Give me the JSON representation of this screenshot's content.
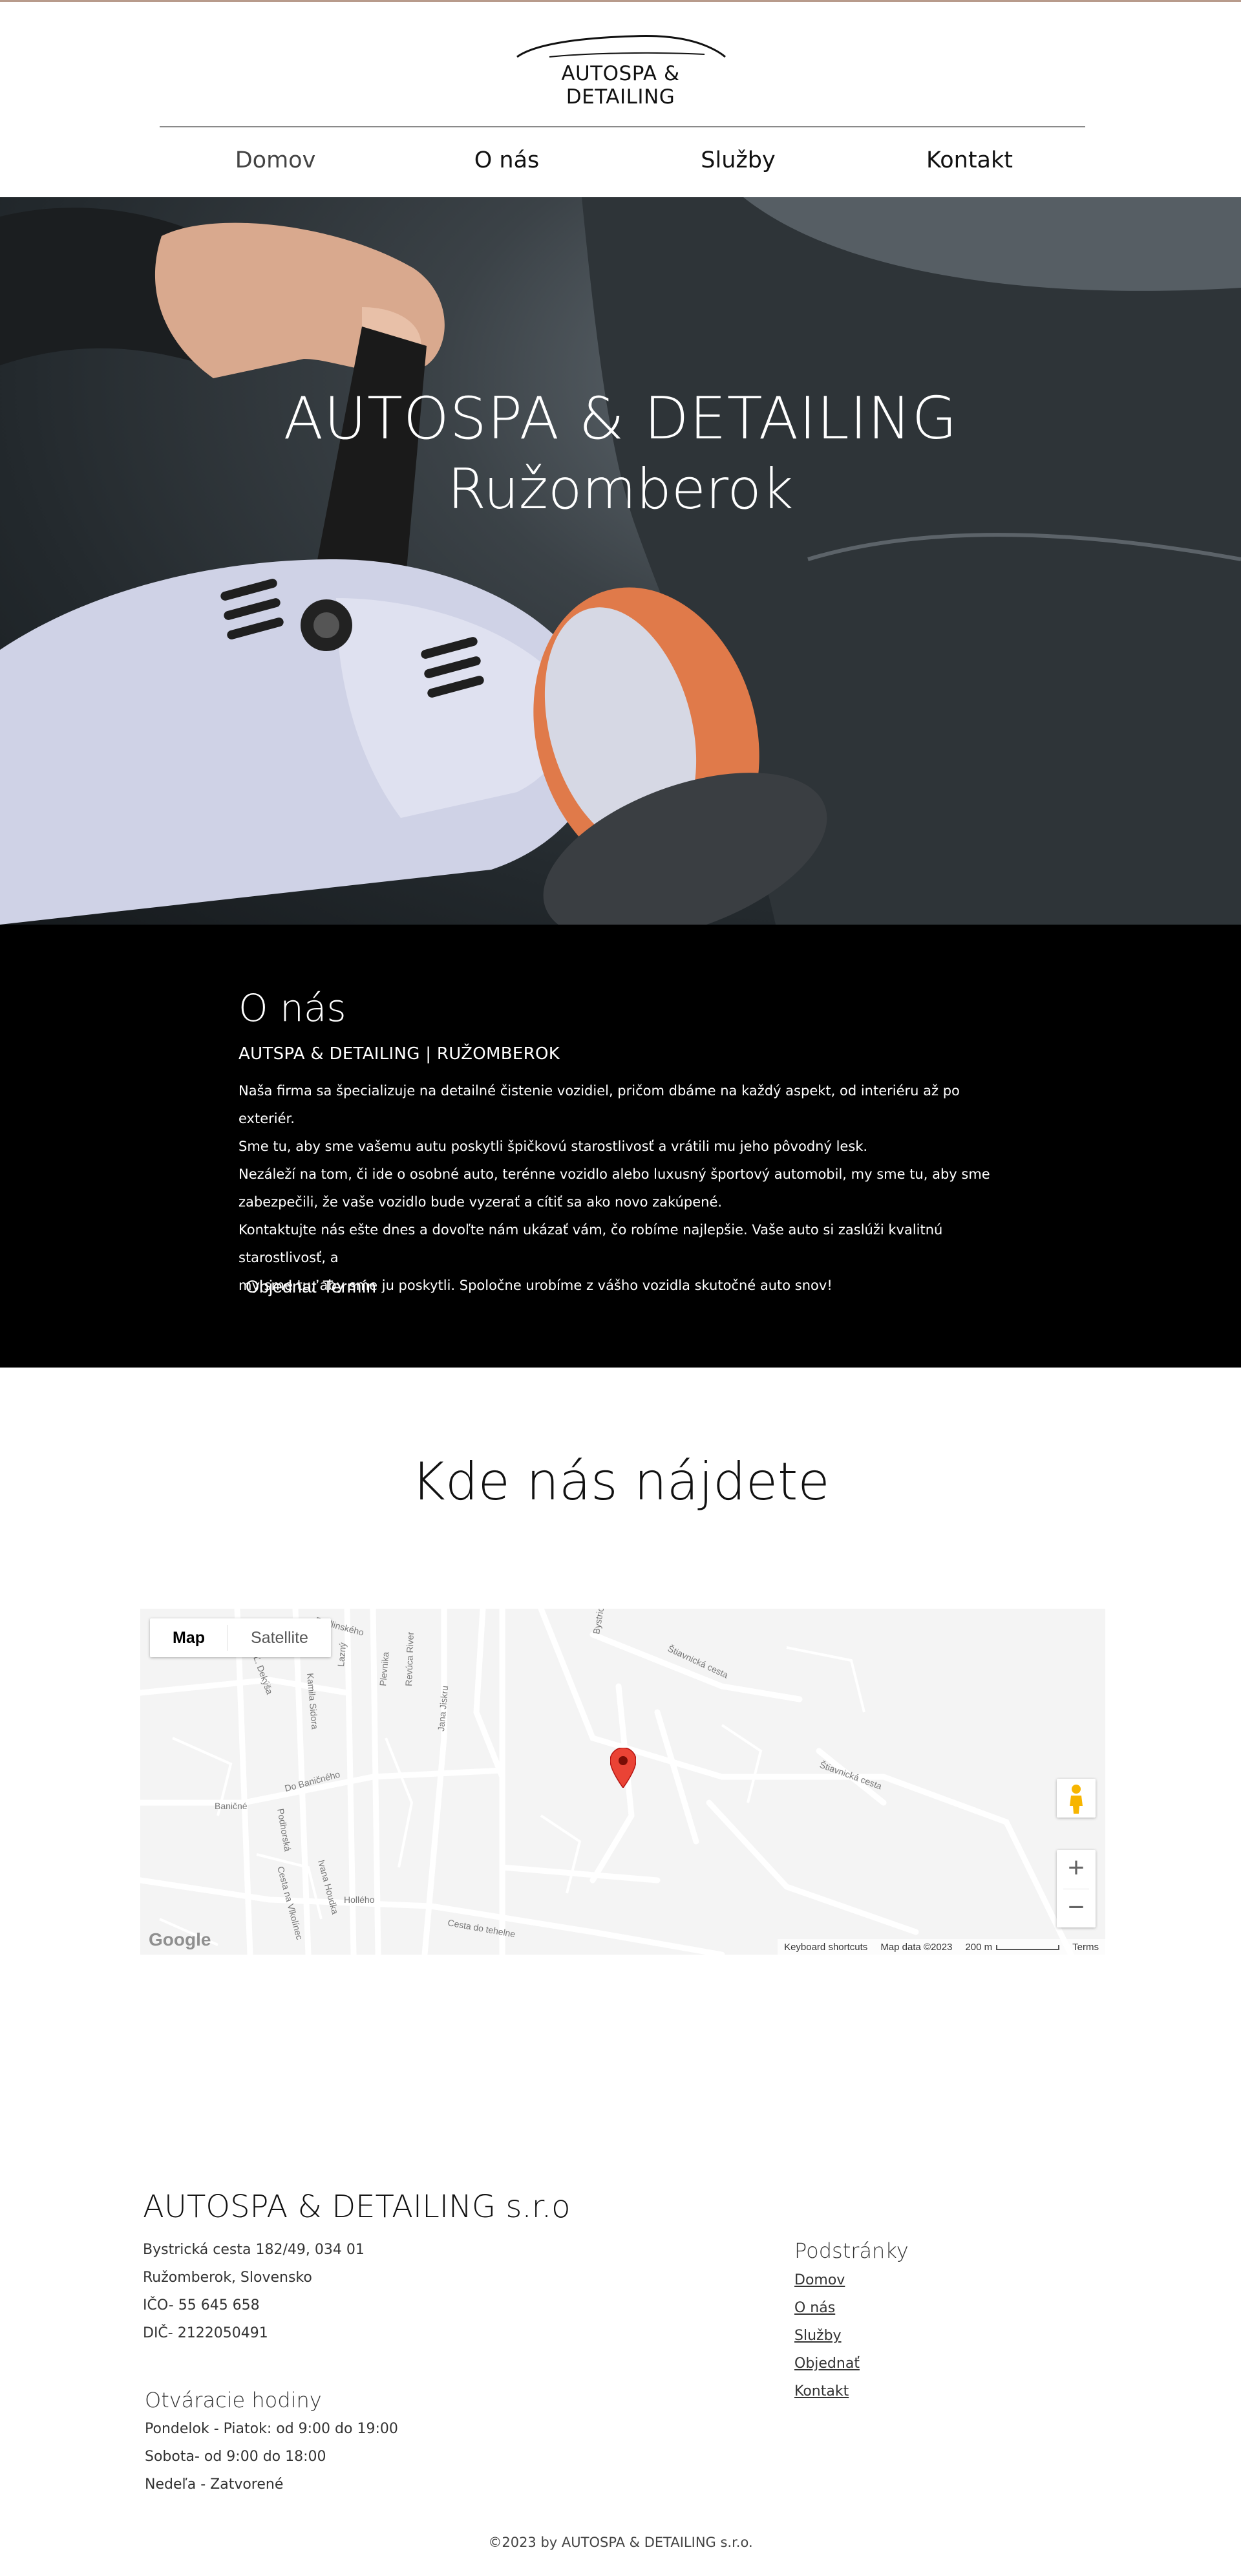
{
  "brand": {
    "logo_text": "AUTOSPA & DETAILING"
  },
  "nav": {
    "items": [
      {
        "label": "Domov"
      },
      {
        "label": "O nás"
      },
      {
        "label": "Služby"
      },
      {
        "label": "Kontakt"
      }
    ]
  },
  "hero": {
    "title_line1": "AUTOSPA & DETAILING",
    "title_line2": "Ružomberok"
  },
  "about": {
    "title": "O nás",
    "subtitle": "AUTSPA & DETAILING | RUŽOMBEROK",
    "lines": [
      "Naša firma sa špecializuje na detailné čistenie vozidiel, pričom dbáme na každý aspekt, od interiéru až po exteriér.",
      "Sme tu, aby sme vašemu autu poskytli špičkovú starostlivosť a vrátili mu jeho pôvodný lesk.",
      "Nezáleží na tom, či ide o osobné auto, terénne vozidlo alebo luxusný športový automobil, my sme tu, aby sme",
      "zabezpečili, že vaše vozidlo bude vyzerať a cítiť sa ako novo zakúpené.",
      "Kontaktujte nás ešte dnes a dovoľte nám ukázať vám, čo robíme najlepšie. Vaše auto si zaslúži kvalitnú starostlivosť, a",
      "my sme tu, aby sme ju poskytli. Spoločne urobíme z vášho vozidla skutočné auto snov!"
    ],
    "button_label": "Objednať Termín"
  },
  "map_section": {
    "title": "Kde nás nájdete",
    "toggle": {
      "map": "Map",
      "satellite": "Satellite"
    },
    "zoom_in": "+",
    "zoom_out": "−",
    "google_logo": "Google",
    "footer": {
      "shortcuts": "Keyboard shortcuts",
      "data": "Map data ©2023",
      "scale": "200 m",
      "terms": "Terms"
    },
    "street_labels": [
      "Radlinského",
      "Ľ. Dekýša",
      "Kamila Sidora",
      "Lazný",
      "Plevnika",
      "Revúca River",
      "Jana Jiskru",
      "Bystrická cesta",
      "Štiavnická cesta",
      "Do Baničného",
      "Baničné",
      "Podhorská",
      "Ivana Houdka",
      "Hollého",
      "Cesta na Vlkolínec",
      "Cesta do tehelne"
    ]
  },
  "footer": {
    "brand": "AUTOSPA & DETAILING s.r.o",
    "address_lines": [
      "Bystrická cesta 182/49, 034 01",
      "Ružomberok, Slovensko",
      "IČO- 55 645 658",
      "DIČ- 2122050491"
    ],
    "hours_title": "Otváracie hodiny",
    "hours_lines": [
      "Pondelok - Piatok: od 9:00 do 19:00",
      "Sobota- od 9:00 do 18:00",
      "Nedeľa - Zatvorené"
    ],
    "pages_title": "Podstránky",
    "pages": [
      {
        "label": "Domov"
      },
      {
        "label": "O nás"
      },
      {
        "label": "Služby"
      },
      {
        "label": "Objednať"
      },
      {
        "label": "Kontakt"
      }
    ],
    "copyright": "©2023 by AUTOSPA & DETAILING s.r.o."
  },
  "colors": {
    "accent_line": "#b89b8c",
    "marker_red": "#ea4335",
    "about_bg": "#000000"
  }
}
